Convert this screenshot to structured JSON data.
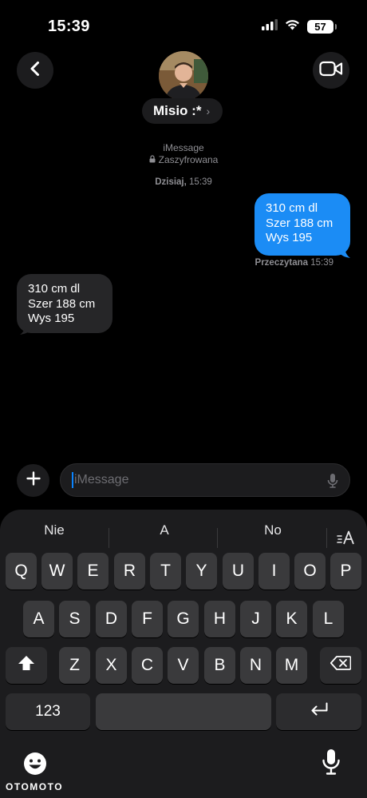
{
  "status": {
    "time": "15:39",
    "battery": "57"
  },
  "header": {
    "contact_name": "Misio :*",
    "chevron": "›"
  },
  "thread": {
    "service": "iMessage",
    "encryption": "Zaszyfrowana",
    "timestamp_day": "Dzisiaj,",
    "timestamp_time": "15:39",
    "read_label": "Przeczytana",
    "read_time": "15:39"
  },
  "messages": [
    {
      "direction": "outgoing",
      "lines": [
        "310 cm dl",
        "Szer 188 cm",
        "Wys 195"
      ]
    },
    {
      "direction": "incoming",
      "lines": [
        "310 cm dl",
        "Szer 188 cm",
        "Wys 195"
      ]
    }
  ],
  "composer": {
    "placeholder": "iMessage"
  },
  "keyboard": {
    "suggestions": [
      "Nie",
      "A",
      "No"
    ],
    "row1": [
      "Q",
      "W",
      "E",
      "R",
      "T",
      "Y",
      "U",
      "I",
      "O",
      "P"
    ],
    "row2": [
      "A",
      "S",
      "D",
      "F",
      "G",
      "H",
      "J",
      "K",
      "L"
    ],
    "row3": [
      "Z",
      "X",
      "C",
      "V",
      "B",
      "N",
      "M"
    ],
    "numbers_label": "123"
  },
  "watermark": "OTOMOTO",
  "icons": {
    "back": "chevron-left-icon",
    "video": "video-camera-icon",
    "lock": "lock-icon",
    "plus": "plus-icon",
    "mic": "microphone-icon",
    "shift": "shift-icon",
    "delete": "backspace-icon",
    "return": "return-icon",
    "emoji": "emoji-icon",
    "format": "text-format-icon"
  },
  "colors": {
    "outgoing_bubble": "#1b8cf5",
    "incoming_bubble": "#262628",
    "accent": "#0a84ff"
  }
}
